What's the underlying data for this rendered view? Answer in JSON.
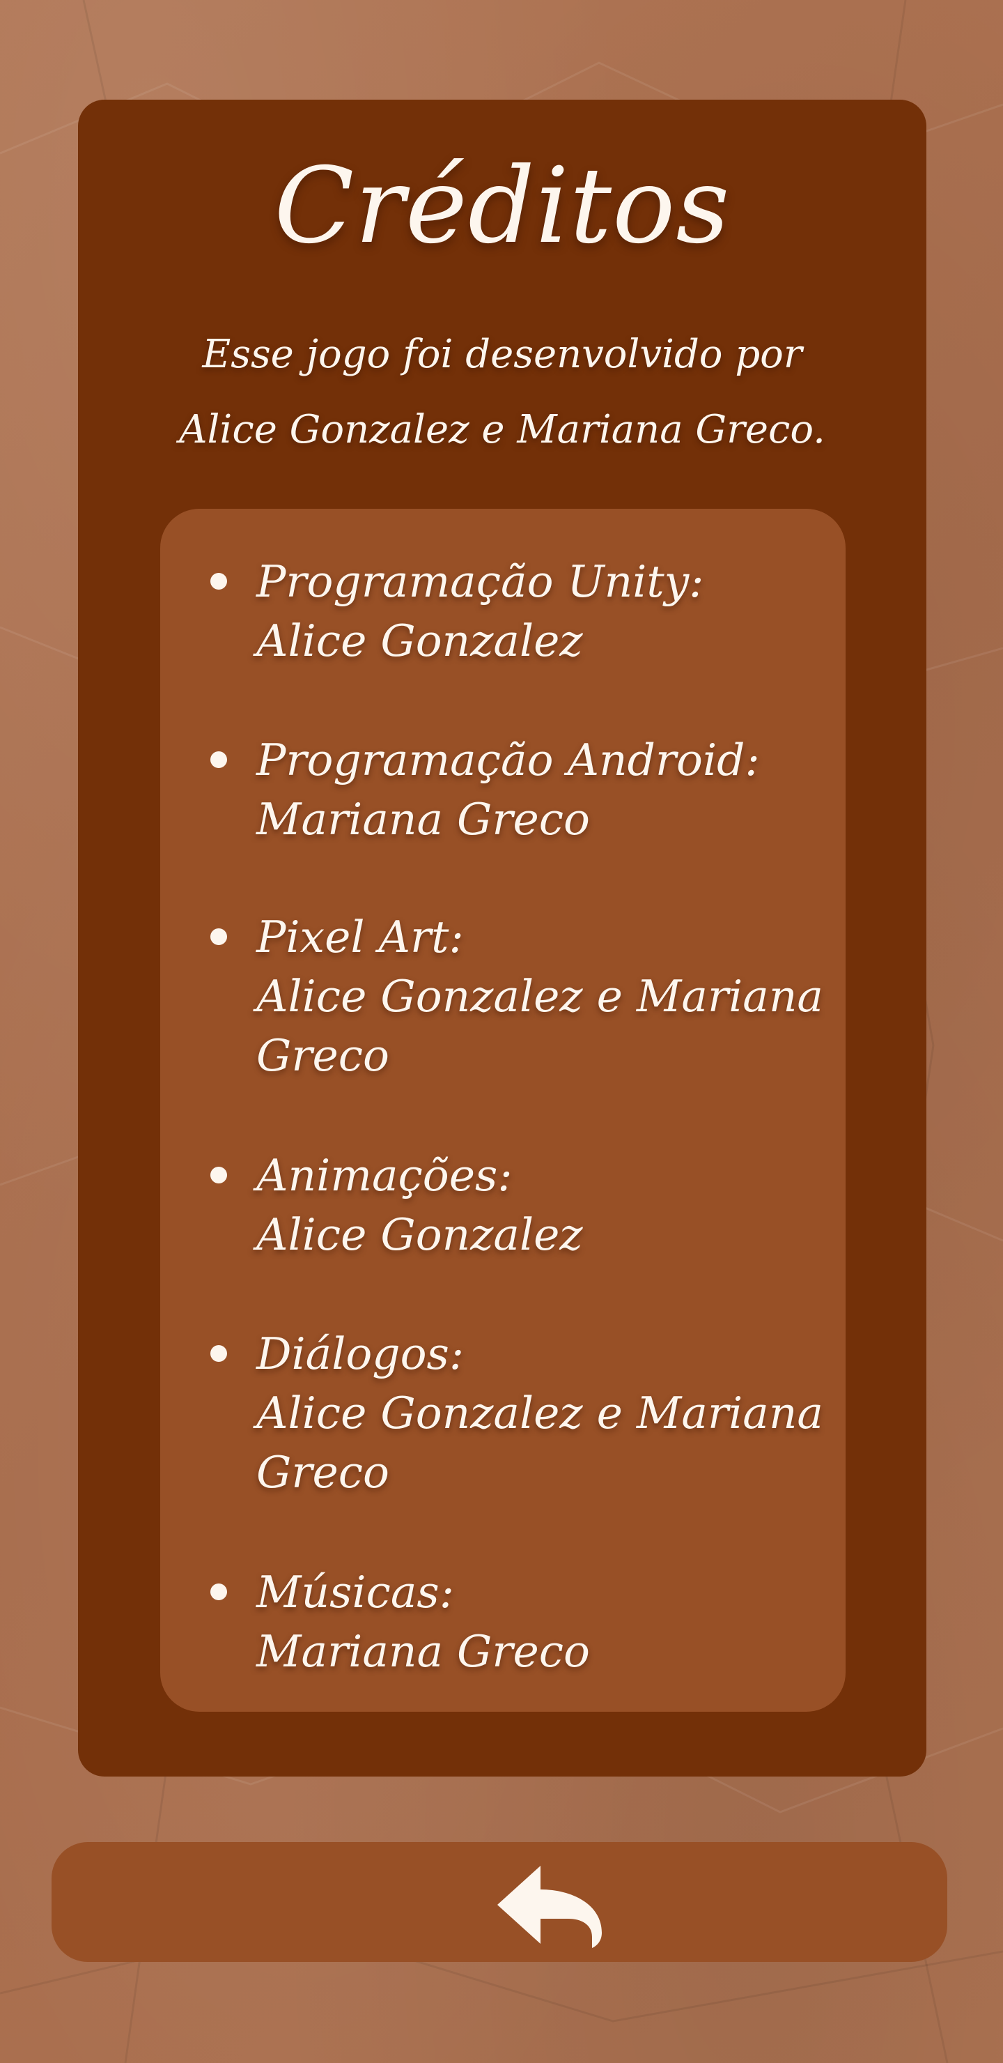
{
  "colors": {
    "background": "#ab7050",
    "panel": "#733008",
    "card": "#985026",
    "text": "#fdf6ee"
  },
  "credits": {
    "title": "Créditos",
    "intro_line1": "Esse jogo foi desenvolvido por",
    "intro_line2": "Alice Gonzalez e Mariana Greco.",
    "roles": [
      {
        "title": "Programação Unity:",
        "names": "Alice Gonzalez"
      },
      {
        "title": "Programação Android:",
        "names": "Mariana Greco"
      },
      {
        "title": "Pixel Art:",
        "names": "Alice Gonzalez e Mariana Greco"
      },
      {
        "title": "Animações:",
        "names": "Alice Gonzalez"
      },
      {
        "title": "Diálogos:",
        "names": "Alice Gonzalez e Mariana Greco"
      },
      {
        "title": "Músicas:",
        "names": "Mariana Greco"
      }
    ]
  },
  "back_button": {
    "icon": "back-arrow-icon"
  }
}
